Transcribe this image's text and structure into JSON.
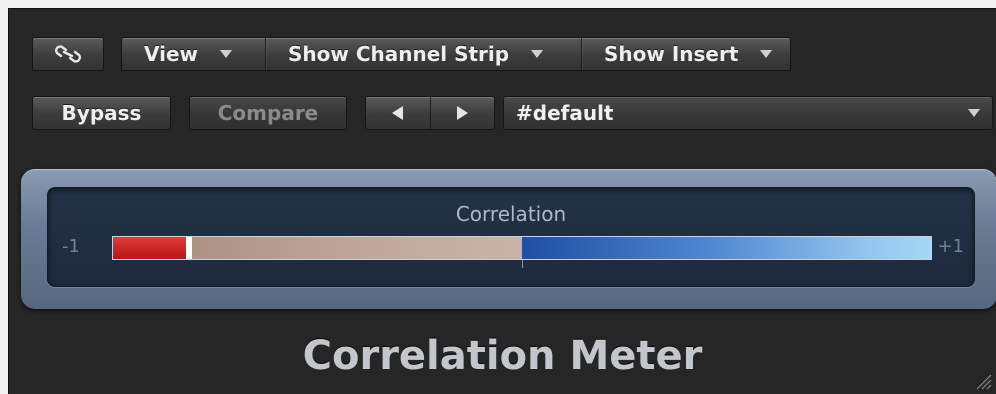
{
  "toolbar": {
    "link_icon": "link-icon",
    "menus": [
      {
        "label": "View"
      },
      {
        "label": "Show Channel Strip"
      },
      {
        "label": "Show Insert"
      }
    ],
    "bypass_label": "Bypass",
    "compare_label": "Compare",
    "prev_icon": "triangle-left-icon",
    "next_icon": "triangle-right-icon",
    "preset_value": "#default"
  },
  "meter": {
    "title": "Correlation",
    "min_label": "-1",
    "max_label": "+1",
    "level_red_fraction": 0.09,
    "marker_fraction": 0.093,
    "colors": {
      "negative_red": "#c81f1f",
      "neutral": "#bfa79a",
      "positive_blue": "#4f86cf"
    }
  },
  "plugin_name": "Correlation Meter"
}
